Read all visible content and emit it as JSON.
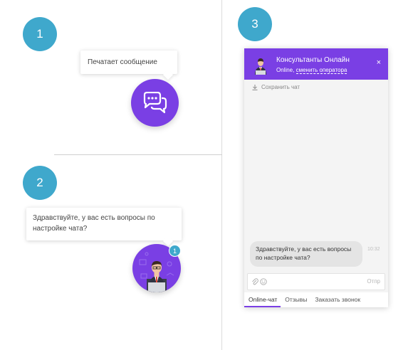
{
  "steps": [
    "1",
    "2",
    "3"
  ],
  "typing_bubble": "Печатает сообщение",
  "greeting_bubble": "Здравствуйте, у вас есть вопросы по настройке чата?",
  "unread_badge": "1",
  "widget": {
    "title": "Консультанты Онлайн",
    "status": "Online,",
    "change_operator": "сменить оператора",
    "close": "×",
    "save_chat": "Сохранить чат",
    "message": "Здравствуйте, у вас есть вопросы по настройке чата?",
    "time": "10:32",
    "send": "Отпр",
    "tabs": [
      "Online-чат",
      "Отзывы",
      "Заказать звонок"
    ]
  },
  "colors": {
    "accent": "#7a3fe4",
    "step": "#3fa8cc"
  }
}
